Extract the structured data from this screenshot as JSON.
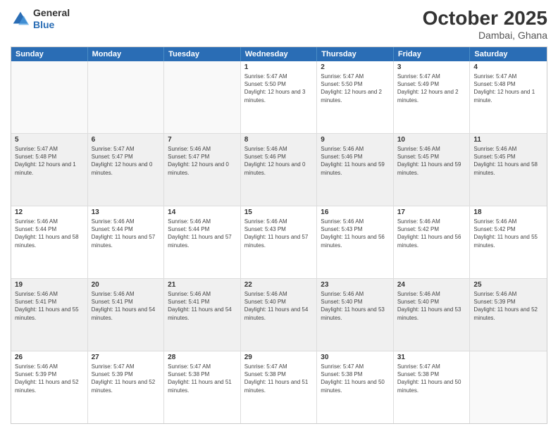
{
  "header": {
    "logo_general": "General",
    "logo_blue": "Blue",
    "month": "October 2025",
    "location": "Dambai, Ghana"
  },
  "weekdays": [
    "Sunday",
    "Monday",
    "Tuesday",
    "Wednesday",
    "Thursday",
    "Friday",
    "Saturday"
  ],
  "rows": [
    [
      {
        "day": "",
        "text": "",
        "empty": true
      },
      {
        "day": "",
        "text": "",
        "empty": true
      },
      {
        "day": "",
        "text": "",
        "empty": true
      },
      {
        "day": "1",
        "text": "Sunrise: 5:47 AM\nSunset: 5:50 PM\nDaylight: 12 hours and 3 minutes."
      },
      {
        "day": "2",
        "text": "Sunrise: 5:47 AM\nSunset: 5:50 PM\nDaylight: 12 hours and 2 minutes."
      },
      {
        "day": "3",
        "text": "Sunrise: 5:47 AM\nSunset: 5:49 PM\nDaylight: 12 hours and 2 minutes."
      },
      {
        "day": "4",
        "text": "Sunrise: 5:47 AM\nSunset: 5:48 PM\nDaylight: 12 hours and 1 minute."
      }
    ],
    [
      {
        "day": "5",
        "text": "Sunrise: 5:47 AM\nSunset: 5:48 PM\nDaylight: 12 hours and 1 minute.",
        "shaded": true
      },
      {
        "day": "6",
        "text": "Sunrise: 5:47 AM\nSunset: 5:47 PM\nDaylight: 12 hours and 0 minutes.",
        "shaded": true
      },
      {
        "day": "7",
        "text": "Sunrise: 5:46 AM\nSunset: 5:47 PM\nDaylight: 12 hours and 0 minutes.",
        "shaded": true
      },
      {
        "day": "8",
        "text": "Sunrise: 5:46 AM\nSunset: 5:46 PM\nDaylight: 12 hours and 0 minutes.",
        "shaded": true
      },
      {
        "day": "9",
        "text": "Sunrise: 5:46 AM\nSunset: 5:46 PM\nDaylight: 11 hours and 59 minutes.",
        "shaded": true
      },
      {
        "day": "10",
        "text": "Sunrise: 5:46 AM\nSunset: 5:45 PM\nDaylight: 11 hours and 59 minutes.",
        "shaded": true
      },
      {
        "day": "11",
        "text": "Sunrise: 5:46 AM\nSunset: 5:45 PM\nDaylight: 11 hours and 58 minutes.",
        "shaded": true
      }
    ],
    [
      {
        "day": "12",
        "text": "Sunrise: 5:46 AM\nSunset: 5:44 PM\nDaylight: 11 hours and 58 minutes."
      },
      {
        "day": "13",
        "text": "Sunrise: 5:46 AM\nSunset: 5:44 PM\nDaylight: 11 hours and 57 minutes."
      },
      {
        "day": "14",
        "text": "Sunrise: 5:46 AM\nSunset: 5:44 PM\nDaylight: 11 hours and 57 minutes."
      },
      {
        "day": "15",
        "text": "Sunrise: 5:46 AM\nSunset: 5:43 PM\nDaylight: 11 hours and 57 minutes."
      },
      {
        "day": "16",
        "text": "Sunrise: 5:46 AM\nSunset: 5:43 PM\nDaylight: 11 hours and 56 minutes."
      },
      {
        "day": "17",
        "text": "Sunrise: 5:46 AM\nSunset: 5:42 PM\nDaylight: 11 hours and 56 minutes."
      },
      {
        "day": "18",
        "text": "Sunrise: 5:46 AM\nSunset: 5:42 PM\nDaylight: 11 hours and 55 minutes."
      }
    ],
    [
      {
        "day": "19",
        "text": "Sunrise: 5:46 AM\nSunset: 5:41 PM\nDaylight: 11 hours and 55 minutes.",
        "shaded": true
      },
      {
        "day": "20",
        "text": "Sunrise: 5:46 AM\nSunset: 5:41 PM\nDaylight: 11 hours and 54 minutes.",
        "shaded": true
      },
      {
        "day": "21",
        "text": "Sunrise: 5:46 AM\nSunset: 5:41 PM\nDaylight: 11 hours and 54 minutes.",
        "shaded": true
      },
      {
        "day": "22",
        "text": "Sunrise: 5:46 AM\nSunset: 5:40 PM\nDaylight: 11 hours and 54 minutes.",
        "shaded": true
      },
      {
        "day": "23",
        "text": "Sunrise: 5:46 AM\nSunset: 5:40 PM\nDaylight: 11 hours and 53 minutes.",
        "shaded": true
      },
      {
        "day": "24",
        "text": "Sunrise: 5:46 AM\nSunset: 5:40 PM\nDaylight: 11 hours and 53 minutes.",
        "shaded": true
      },
      {
        "day": "25",
        "text": "Sunrise: 5:46 AM\nSunset: 5:39 PM\nDaylight: 11 hours and 52 minutes.",
        "shaded": true
      }
    ],
    [
      {
        "day": "26",
        "text": "Sunrise: 5:46 AM\nSunset: 5:39 PM\nDaylight: 11 hours and 52 minutes."
      },
      {
        "day": "27",
        "text": "Sunrise: 5:47 AM\nSunset: 5:39 PM\nDaylight: 11 hours and 52 minutes."
      },
      {
        "day": "28",
        "text": "Sunrise: 5:47 AM\nSunset: 5:38 PM\nDaylight: 11 hours and 51 minutes."
      },
      {
        "day": "29",
        "text": "Sunrise: 5:47 AM\nSunset: 5:38 PM\nDaylight: 11 hours and 51 minutes."
      },
      {
        "day": "30",
        "text": "Sunrise: 5:47 AM\nSunset: 5:38 PM\nDaylight: 11 hours and 50 minutes."
      },
      {
        "day": "31",
        "text": "Sunrise: 5:47 AM\nSunset: 5:38 PM\nDaylight: 11 hours and 50 minutes."
      },
      {
        "day": "",
        "text": "",
        "empty": true
      }
    ]
  ]
}
